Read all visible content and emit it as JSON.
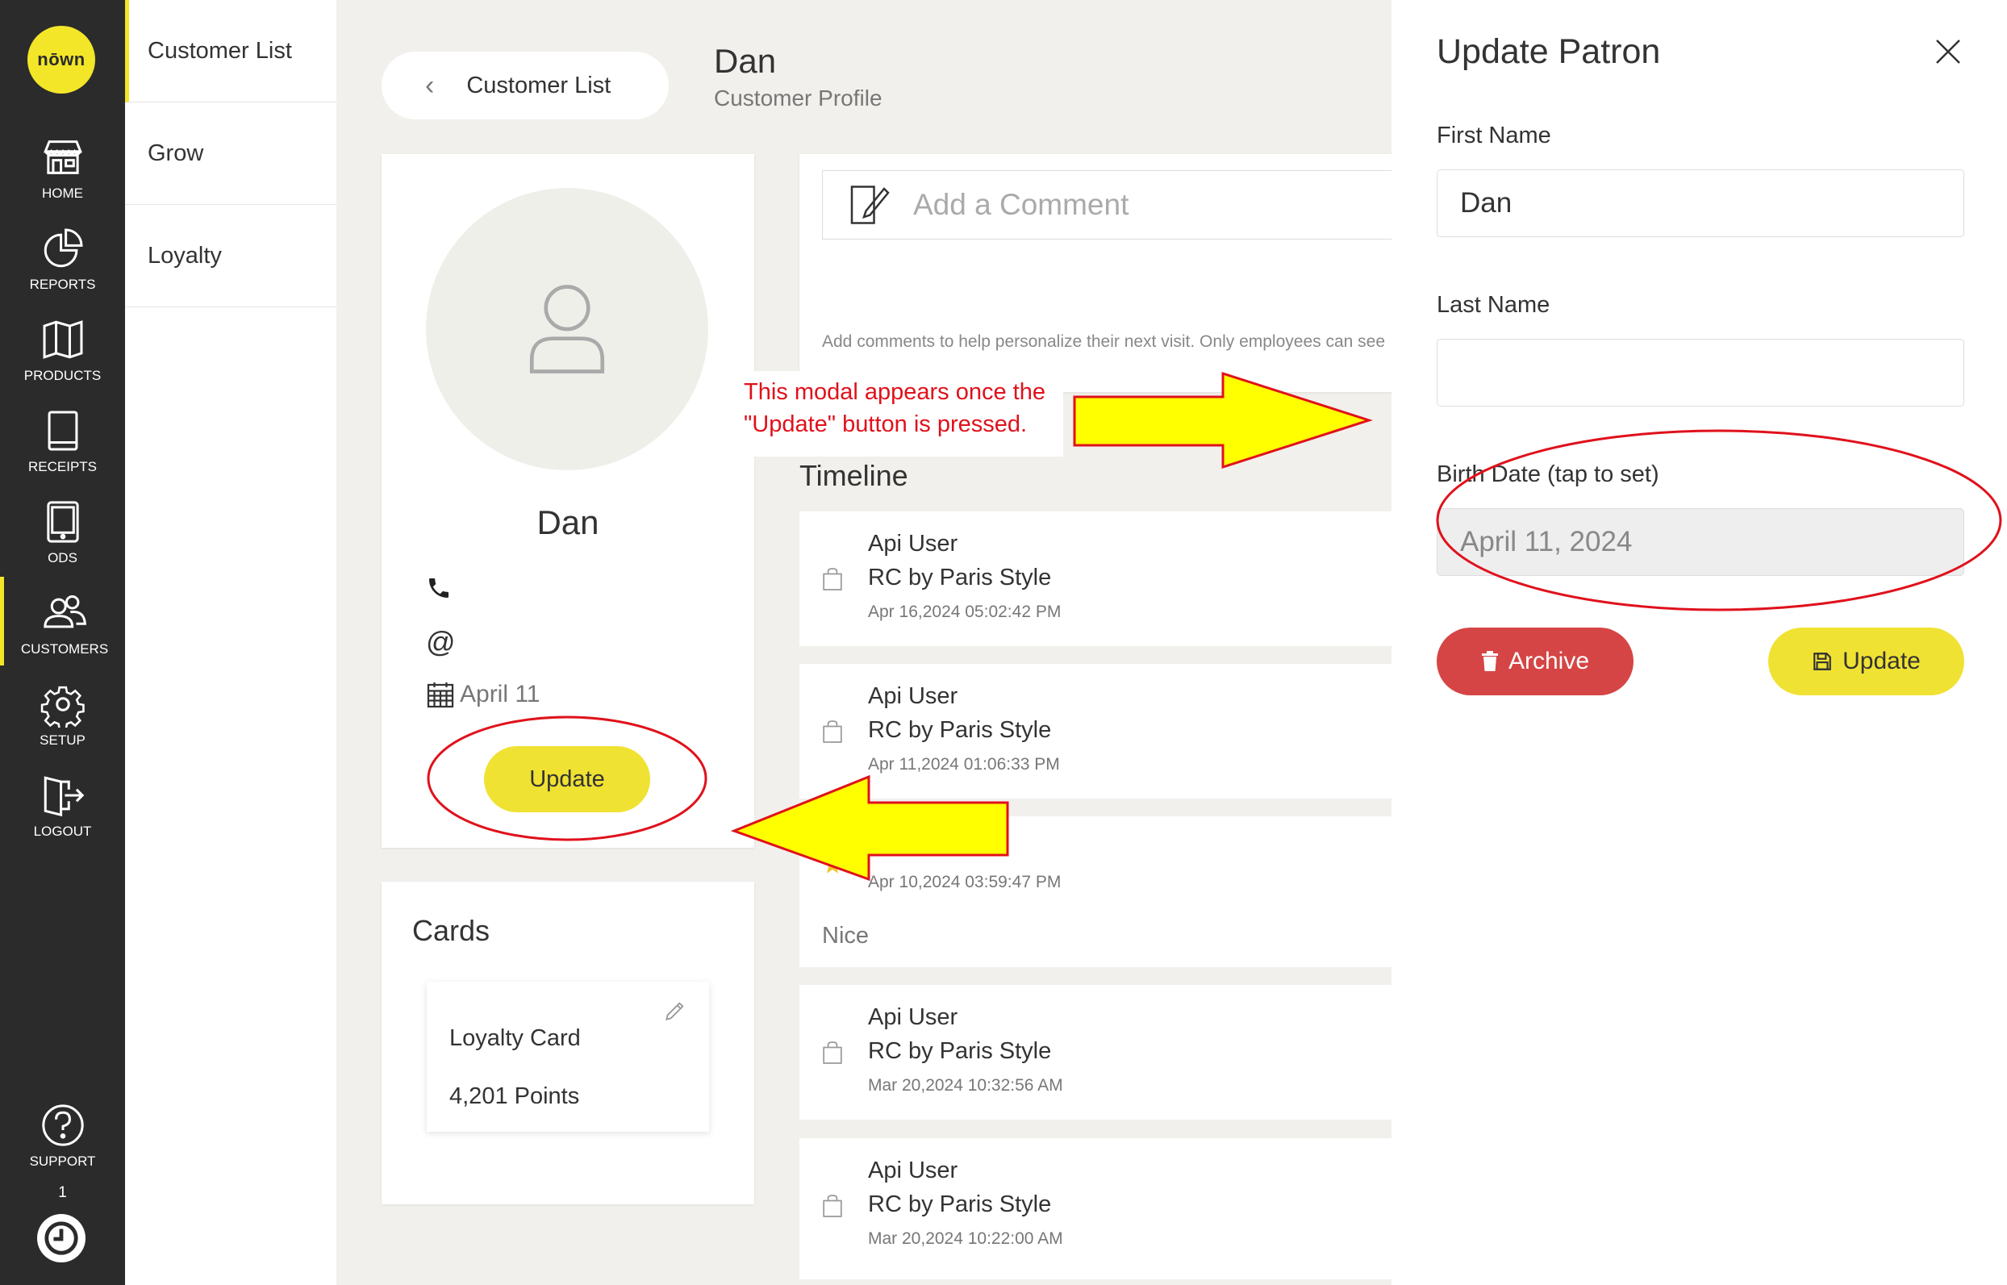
{
  "nav": {
    "logo": "nōwn",
    "items": [
      {
        "label": "HOME",
        "icon": "store-icon"
      },
      {
        "label": "REPORTS",
        "icon": "pie-chart-icon"
      },
      {
        "label": "PRODUCTS",
        "icon": "map-icon"
      },
      {
        "label": "RECEIPTS",
        "icon": "book-icon"
      },
      {
        "label": "ODS",
        "icon": "tablet-icon"
      },
      {
        "label": "CUSTOMERS",
        "icon": "users-icon"
      },
      {
        "label": "SETUP",
        "icon": "gear-icon"
      },
      {
        "label": "LOGOUT",
        "icon": "logout-icon"
      },
      {
        "label": "SUPPORT",
        "icon": "help-icon"
      }
    ],
    "counter": "1"
  },
  "submenu": {
    "items": [
      {
        "label": "Customer List"
      },
      {
        "label": "Grow"
      },
      {
        "label": "Loyalty"
      }
    ]
  },
  "header": {
    "back_label": "Customer List",
    "title": "Dan",
    "subtitle": "Customer Profile"
  },
  "profile": {
    "name": "Dan",
    "phone": "",
    "email_symbol": "@",
    "birthday": "April 11",
    "update_label": "Update"
  },
  "cards": {
    "title": "Cards",
    "loyalty_name": "Loyalty Card",
    "loyalty_points": "4,201 Points"
  },
  "comment": {
    "placeholder": "Add a Comment",
    "hint": "Add comments to help personalize their next visit. Only employees can see"
  },
  "timeline": {
    "title": "Timeline",
    "items": [
      {
        "user": "Api User",
        "store": "RC by Paris Style",
        "time": "Apr 16,2024 05:02:42 PM"
      },
      {
        "user": "Api User",
        "store": "RC by Paris Style",
        "time": "Apr 11,2024 01:06:33 PM"
      },
      {
        "time": "Apr 10,2024 03:59:47 PM",
        "note": "Nice"
      },
      {
        "user": "Api User",
        "store": "RC by Paris Style",
        "time": "Mar 20,2024 10:32:56 AM"
      },
      {
        "user": "Api User",
        "store": "RC by Paris Style",
        "time": "Mar 20,2024 10:22:00 AM"
      }
    ]
  },
  "annotation": {
    "line1": "This modal appears once the",
    "line2": "\"Update\" button is pressed."
  },
  "modal": {
    "title": "Update Patron",
    "first_name_label": "First Name",
    "first_name_value": "Dan",
    "last_name_label": "Last Name",
    "last_name_value": "",
    "birth_label": "Birth Date (tap to set)",
    "birth_value": "April 11, 2024",
    "archive_label": "Archive",
    "update_label": "Update"
  },
  "colors": {
    "accent": "#f0e232",
    "nav_bg": "#2b2b2b",
    "archive": "#d64545",
    "annotation": "#e0111b",
    "arrow": "#ffff00"
  }
}
